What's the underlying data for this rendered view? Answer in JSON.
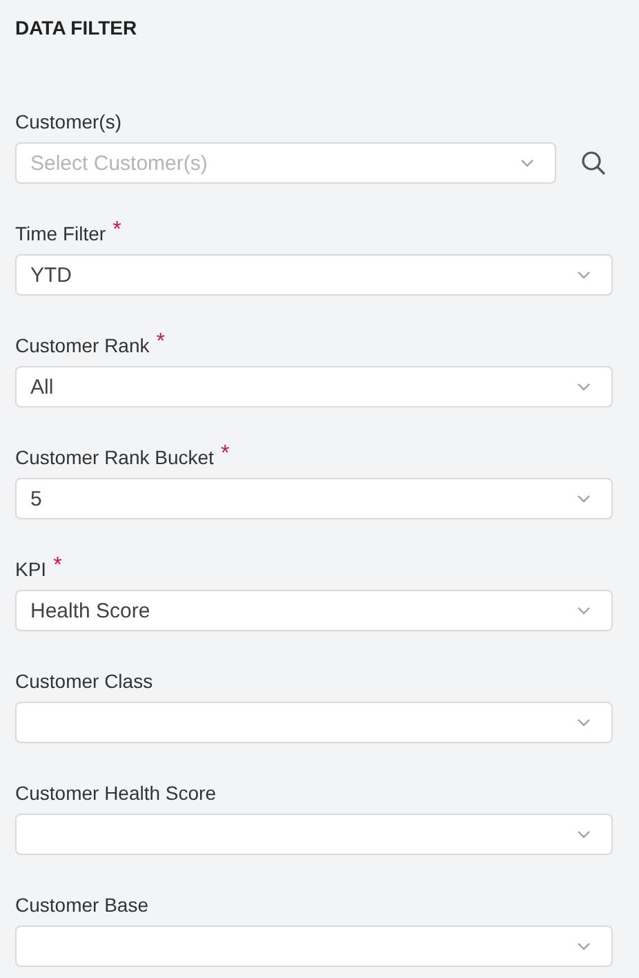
{
  "title": "DATA FILTER",
  "fields": [
    {
      "label": "Customer(s)",
      "placeholder": "Select Customer(s)",
      "kind": "search-select"
    },
    {
      "label": "Time Filter",
      "required_mark": "*",
      "value": "YTD",
      "kind": "select"
    },
    {
      "label": "Customer Rank",
      "required_mark": "*",
      "value": "All",
      "kind": "select"
    },
    {
      "label": "Customer Rank Bucket",
      "required_mark": "*",
      "value": "5",
      "kind": "select"
    },
    {
      "label": "KPI",
      "required_mark": "*",
      "value": "Health Score",
      "kind": "select"
    },
    {
      "label": "Customer Class",
      "kind": "select"
    },
    {
      "label": "Customer Health Score",
      "kind": "select"
    },
    {
      "label": "Customer Base",
      "kind": "select"
    }
  ]
}
